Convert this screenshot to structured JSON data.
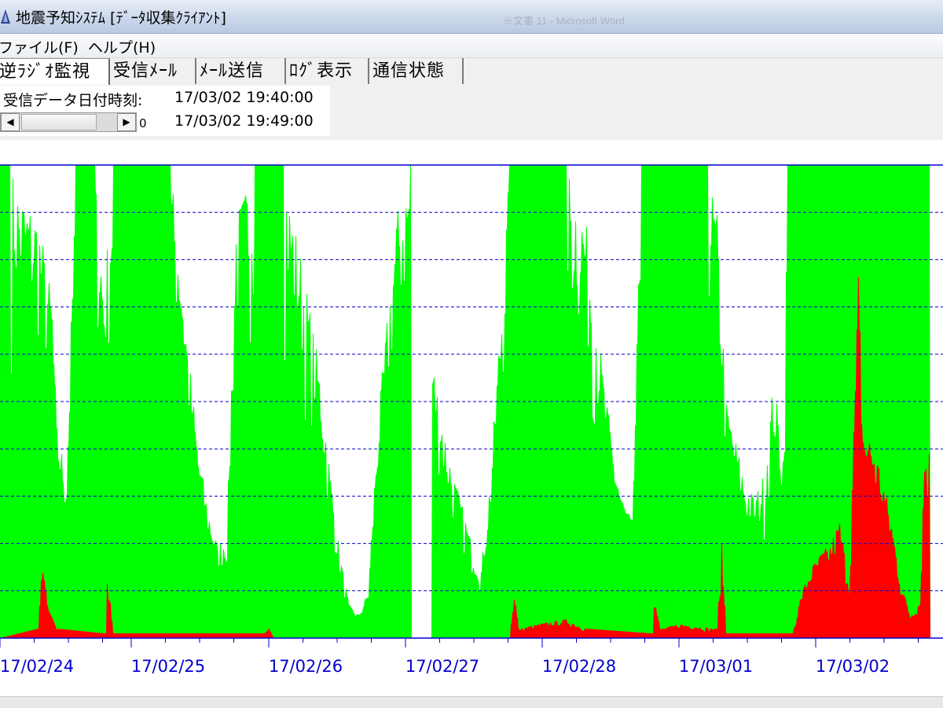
{
  "window": {
    "title": "地震予知ｼｽﾃﾑ [ﾃﾞｰﾀ収集ｸﾗｲｱﾝﾄ]",
    "background_title": "※文書 11 - Microsoft Word"
  },
  "menu": {
    "items": [
      "ファイル(F)",
      "ヘルプ(H)"
    ]
  },
  "tabs": [
    {
      "label": "逆ﾗｼﾞｵ監視",
      "active": true
    },
    {
      "label": "受信ﾒｰﾙ",
      "active": false
    },
    {
      "label": "ﾒｰﾙ送信",
      "active": false
    },
    {
      "label": "ﾛｸﾞ表示",
      "active": false
    },
    {
      "label": "通信状態",
      "active": false
    }
  ],
  "info": {
    "label": "受信データ日付時刻:",
    "time_start": "17/03/02 19:40:00",
    "time_end": "17/03/02 19:49:00",
    "scroll_value": "0"
  },
  "colors": {
    "green": "#00ff00",
    "red": "#ff0000",
    "grid": "#0000cc"
  },
  "chart_data": {
    "type": "area",
    "x_ticks": [
      "17/02/24",
      "17/02/25",
      "17/02/26",
      "17/02/27",
      "17/02/28",
      "17/03/01",
      "17/03/02"
    ],
    "grid": true,
    "series": [
      {
        "color": "green",
        "upper_envelope_fraction": [
          [
            0.0,
            1.0
          ],
          [
            0.01,
            1.0
          ],
          [
            0.02,
            0.95
          ],
          [
            0.04,
            0.9
          ],
          [
            0.055,
            0.72
          ],
          [
            0.06,
            0.45
          ],
          [
            0.065,
            0.4
          ],
          [
            0.07,
            0.35
          ],
          [
            0.08,
            1.0
          ],
          [
            0.1,
            1.0
          ],
          [
            0.11,
            0.75
          ],
          [
            0.12,
            1.0
          ],
          [
            0.18,
            1.0
          ],
          [
            0.19,
            0.85
          ],
          [
            0.2,
            0.6
          ],
          [
            0.21,
            0.4
          ],
          [
            0.22,
            0.28
          ],
          [
            0.23,
            0.2
          ],
          [
            0.24,
            0.22
          ],
          [
            0.25,
            0.9
          ],
          [
            0.27,
            1.0
          ],
          [
            0.3,
            1.0
          ],
          [
            0.32,
            0.8
          ],
          [
            0.34,
            0.55
          ],
          [
            0.35,
            0.35
          ],
          [
            0.36,
            0.18
          ],
          [
            0.37,
            0.07
          ],
          [
            0.38,
            0.05
          ],
          [
            0.39,
            0.1
          ],
          [
            0.4,
            0.45
          ],
          [
            0.42,
            0.9
          ],
          [
            0.435,
            1.0
          ],
          [
            0.437,
            0.0
          ],
          [
            0.455,
            0.0
          ],
          [
            0.458,
            0.6
          ],
          [
            0.47,
            0.45
          ],
          [
            0.48,
            0.35
          ],
          [
            0.49,
            0.28
          ],
          [
            0.5,
            0.2
          ],
          [
            0.51,
            0.15
          ],
          [
            0.52,
            0.35
          ],
          [
            0.54,
            1.0
          ],
          [
            0.6,
            1.0
          ],
          [
            0.62,
            0.9
          ],
          [
            0.64,
            0.55
          ],
          [
            0.65,
            0.4
          ],
          [
            0.66,
            0.3
          ],
          [
            0.67,
            0.25
          ],
          [
            0.68,
            1.0
          ],
          [
            0.75,
            1.0
          ],
          [
            0.76,
            0.9
          ],
          [
            0.77,
            0.5
          ],
          [
            0.78,
            0.42
          ],
          [
            0.79,
            0.33
          ],
          [
            0.8,
            0.3
          ],
          [
            0.81,
            0.35
          ],
          [
            0.82,
            0.55
          ],
          [
            0.83,
            0.4
          ],
          [
            0.835,
            1.0
          ],
          [
            0.985,
            1.0
          ],
          [
            0.987,
            0.0
          ],
          [
            1.0,
            0.0
          ]
        ]
      },
      {
        "color": "red",
        "upper_envelope_fraction": [
          [
            0.0,
            0.0
          ],
          [
            0.04,
            0.02
          ],
          [
            0.045,
            0.18
          ],
          [
            0.05,
            0.07
          ],
          [
            0.06,
            0.02
          ],
          [
            0.11,
            0.01
          ],
          [
            0.112,
            0.18
          ],
          [
            0.12,
            0.01
          ],
          [
            0.28,
            0.01
          ],
          [
            0.285,
            0.02
          ],
          [
            0.29,
            0.0
          ],
          [
            0.54,
            0.0
          ],
          [
            0.545,
            0.1
          ],
          [
            0.55,
            0.02
          ],
          [
            0.57,
            0.03
          ],
          [
            0.6,
            0.04
          ],
          [
            0.62,
            0.02
          ],
          [
            0.69,
            0.01
          ],
          [
            0.692,
            0.1
          ],
          [
            0.7,
            0.02
          ],
          [
            0.72,
            0.03
          ],
          [
            0.76,
            0.02
          ],
          [
            0.765,
            0.2
          ],
          [
            0.77,
            0.01
          ],
          [
            0.84,
            0.01
          ],
          [
            0.85,
            0.1
          ],
          [
            0.86,
            0.15
          ],
          [
            0.87,
            0.18
          ],
          [
            0.88,
            0.2
          ],
          [
            0.89,
            0.25
          ],
          [
            0.9,
            0.12
          ],
          [
            0.91,
            0.78
          ],
          [
            0.915,
            0.45
          ],
          [
            0.925,
            0.42
          ],
          [
            0.935,
            0.35
          ],
          [
            0.945,
            0.25
          ],
          [
            0.955,
            0.12
          ],
          [
            0.965,
            0.05
          ],
          [
            0.975,
            0.08
          ],
          [
            0.98,
            0.4
          ],
          [
            0.985,
            0.4
          ],
          [
            0.987,
            0.0
          ],
          [
            1.0,
            0.0
          ]
        ]
      }
    ]
  }
}
